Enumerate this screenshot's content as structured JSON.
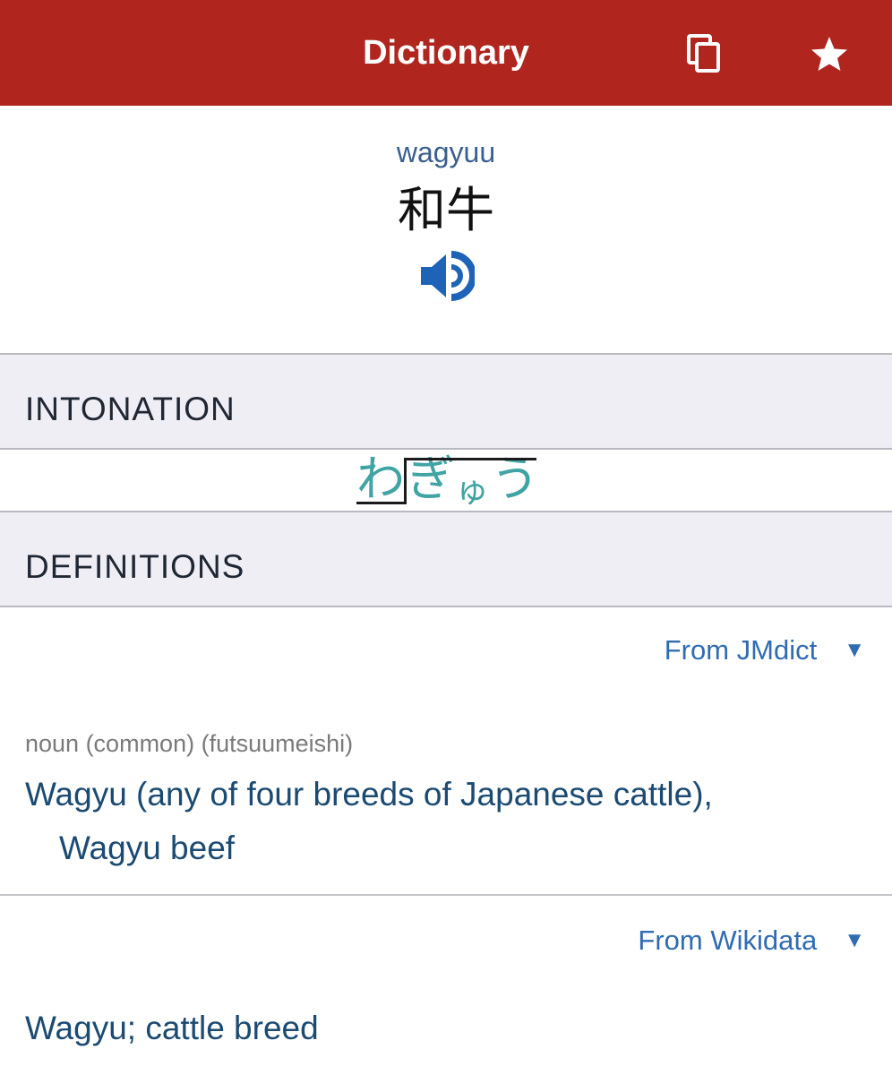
{
  "app_bar": {
    "title": "Dictionary",
    "copy_icon": "copy-icon",
    "star_icon": "star-icon",
    "background": "#b0261f"
  },
  "entry": {
    "romaji": "wagyuu",
    "kanji": "和牛",
    "audio_icon": "speaker-icon"
  },
  "intonation": {
    "header": "INTONATION",
    "kana": [
      "わ",
      "ぎ",
      "ゅ",
      "う"
    ]
  },
  "definitions": {
    "header": "DEFINITIONS",
    "sources": [
      {
        "label": "From JMdict",
        "arrow": "▼",
        "part_of_speech": "noun (common) (futsuumeishi)",
        "gloss_line1": "Wagyu (any of four breeds of Japanese cattle),",
        "gloss_line2": "Wagyu beef"
      },
      {
        "label": "From Wikidata",
        "arrow": "▼",
        "gloss": "Wagyu; cattle breed"
      }
    ]
  }
}
